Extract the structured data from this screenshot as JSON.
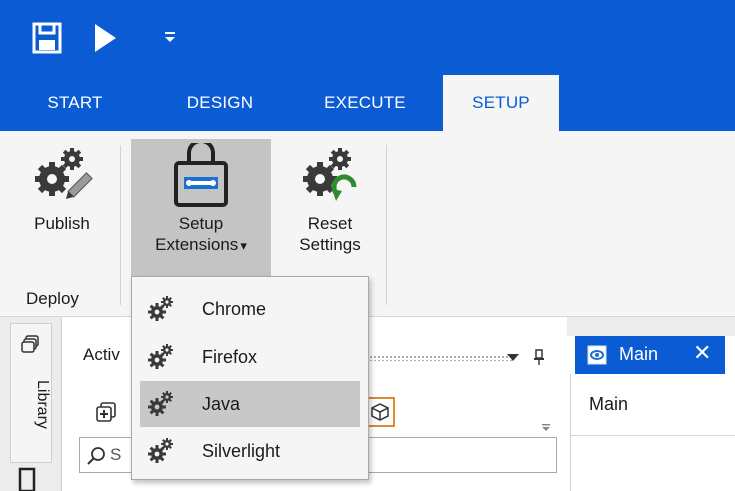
{
  "colors": {
    "accent": "#0b5bd4",
    "ribbon_bg": "#f5f5f5",
    "pressed": "#c4c4c4",
    "highlight": "#c8c8c8"
  },
  "quick_access": {
    "icons": [
      "save-icon",
      "run-icon",
      "customize-quick-access-icon"
    ]
  },
  "ribbon_tabs": [
    {
      "label": "START",
      "active": false
    },
    {
      "label": "DESIGN",
      "active": false
    },
    {
      "label": "EXECUTE",
      "active": false
    },
    {
      "label": "SETUP",
      "active": true
    }
  ],
  "ribbon": {
    "publish": {
      "label": "Publish",
      "icon": "gears-pencil-icon"
    },
    "setup_extensions": {
      "line1": "Setup",
      "line2": "Extensions",
      "caret": "▾",
      "icon": "toolbox-icon"
    },
    "reset_settings": {
      "line1": "Reset",
      "line2": "Settings",
      "icon": "gears-reset-icon"
    },
    "group_label": "Deploy"
  },
  "extensions_menu": {
    "items": [
      {
        "label": "Chrome",
        "icon": "gears-icon",
        "highlighted": false
      },
      {
        "label": "Firefox",
        "icon": "gears-icon",
        "highlighted": false
      },
      {
        "label": "Java",
        "icon": "gears-icon",
        "highlighted": true
      },
      {
        "label": "Silverlight",
        "icon": "gears-icon",
        "highlighted": false
      }
    ]
  },
  "sidebar": {
    "tab_label": "Library"
  },
  "activities_panel": {
    "title_visible": "Activ",
    "search_placeholder_visible": "S"
  },
  "document": {
    "tab_title": "Main",
    "close_glyph": "✕",
    "heading": "Main"
  }
}
